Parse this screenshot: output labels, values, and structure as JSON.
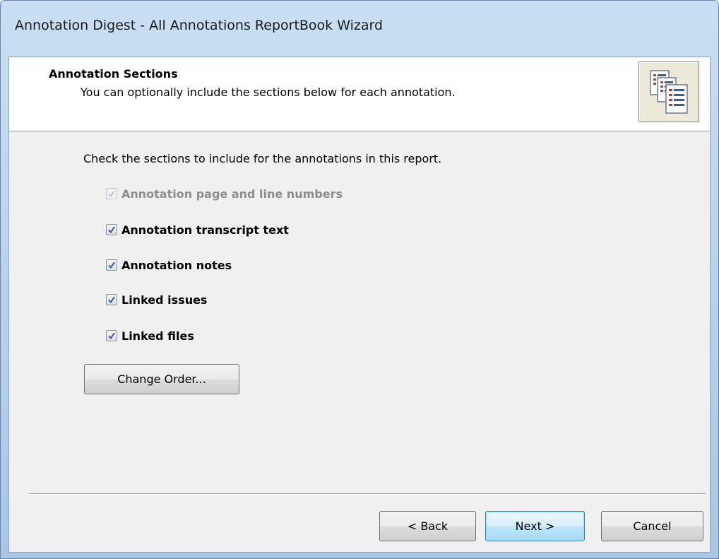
{
  "window": {
    "title": "Annotation Digest - All Annotations ReportBook Wizard"
  },
  "header": {
    "title": "Annotation Sections",
    "subtitle": "You can optionally include the sections below for each annotation.",
    "icon": "documents-report-icon"
  },
  "body": {
    "instruction": "Check the sections to include for the annotations in this report.",
    "sections": [
      {
        "label": "Annotation page and line numbers",
        "checked": true,
        "enabled": false
      },
      {
        "label": "Annotation transcript text",
        "checked": true,
        "enabled": true
      },
      {
        "label": "Annotation notes",
        "checked": true,
        "enabled": true
      },
      {
        "label": "Linked issues",
        "checked": true,
        "enabled": true
      },
      {
        "label": "Linked files",
        "checked": true,
        "enabled": true
      }
    ],
    "change_order_label": "Change Order..."
  },
  "footer": {
    "back_label": "< Back",
    "next_label": "Next >",
    "cancel_label": "Cancel"
  },
  "colors": {
    "check_mark": "#2a5dab",
    "default_button_border": "#3c7fb1",
    "titlebar": "#b6d0ea",
    "dialog_bg": "#f0f0f0"
  }
}
